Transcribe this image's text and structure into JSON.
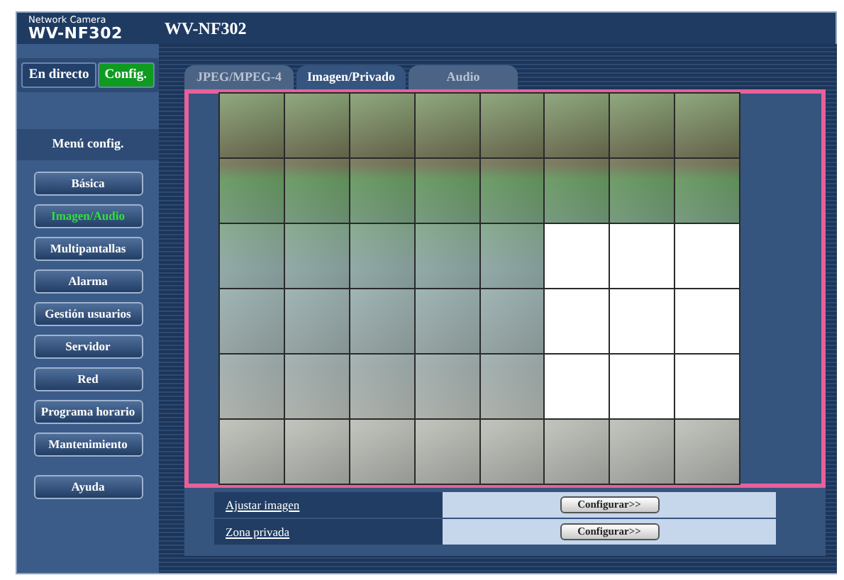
{
  "header": {
    "brand_small": "Network Camera",
    "brand_model": "WV-NF302",
    "title": "WV-NF302"
  },
  "mode_buttons": [
    {
      "label": "En directo",
      "selected": false
    },
    {
      "label": "Config.",
      "selected": true
    }
  ],
  "menu_title": "Menú config.",
  "menu": [
    {
      "label": "Básica",
      "selected": false
    },
    {
      "label": "Imagen/Audio",
      "selected": true
    },
    {
      "label": "Multipantallas",
      "selected": false
    },
    {
      "label": "Alarma",
      "selected": false
    },
    {
      "label": "Gestión usuarios",
      "selected": false
    },
    {
      "label": "Servidor",
      "selected": false
    },
    {
      "label": "Red",
      "selected": false
    },
    {
      "label": "Programa horario",
      "selected": false
    },
    {
      "label": "Mantenimiento",
      "selected": false
    },
    {
      "label": "Ayuda",
      "selected": false
    }
  ],
  "tabs": [
    {
      "label": "JPEG/MPEG-4",
      "selected": false
    },
    {
      "label": "Imagen/Privado",
      "selected": true
    },
    {
      "label": "Audio",
      "selected": false
    }
  ],
  "privacy_grid": [
    [
      false,
      false,
      false,
      false,
      false,
      false,
      false,
      false
    ],
    [
      false,
      false,
      false,
      false,
      false,
      false,
      false,
      false
    ],
    [
      false,
      false,
      false,
      false,
      false,
      true,
      true,
      true
    ],
    [
      false,
      false,
      false,
      false,
      false,
      true,
      true,
      true
    ],
    [
      false,
      false,
      false,
      false,
      false,
      true,
      true,
      true
    ],
    [
      false,
      false,
      false,
      false,
      false,
      false,
      false,
      false
    ]
  ],
  "settings": [
    {
      "link": "Ajustar imagen",
      "button": "Configurar>>"
    },
    {
      "link": "Zona privada",
      "button": "Configurar>>"
    }
  ]
}
